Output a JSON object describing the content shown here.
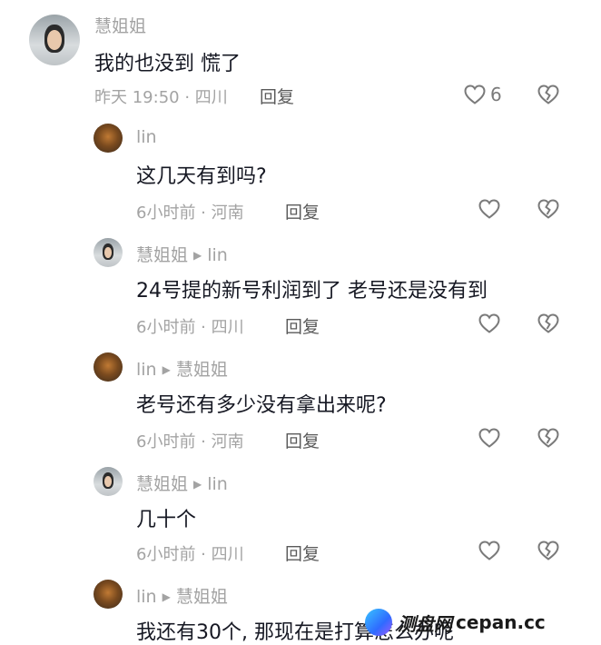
{
  "comments": [
    {
      "name": "慧姐姐",
      "reply_to": "",
      "text": "我的也没到 慌了",
      "meta": "昨天 19:50 · 四川",
      "reply": "回复",
      "likes": "6"
    },
    {
      "name": "lin",
      "reply_to": "",
      "text": "这几天有到吗?",
      "meta": "6小时前 · 河南",
      "reply": "回复",
      "likes": ""
    },
    {
      "name": "慧姐姐",
      "reply_to": "lin",
      "text": "24号提的新号利润到了 老号还是没有到",
      "meta": "6小时前 · 四川",
      "reply": "回复",
      "likes": ""
    },
    {
      "name": "lin",
      "reply_to": "慧姐姐",
      "text": "老号还有多少没有拿出来呢?",
      "meta": "6小时前 · 河南",
      "reply": "回复",
      "likes": ""
    },
    {
      "name": "慧姐姐",
      "reply_to": "lin",
      "text": "几十个",
      "meta": "6小时前 · 四川",
      "reply": "回复",
      "likes": ""
    },
    {
      "name": "lin",
      "reply_to": "慧姐姐",
      "text": "我还有30个, 那现在是打算怎么办呢",
      "meta": "",
      "reply": "",
      "likes": ""
    }
  ],
  "watermark": {
    "cn": "测盘网",
    "en": "cepan.cc"
  },
  "colors": {
    "text": "#161823",
    "secondary": "#a3a3a3",
    "icon": "#7a7a7a"
  }
}
